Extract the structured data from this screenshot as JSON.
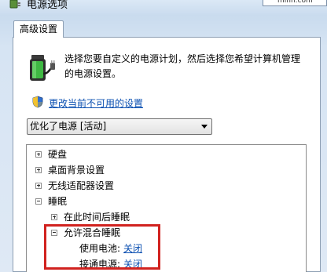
{
  "window": {
    "title": "电源选项",
    "top_right_field_text": "minn.com"
  },
  "tabs": [
    {
      "label": "高级设置"
    }
  ],
  "intro": {
    "text": "选择您要自定义的电源计划，然后选择您希望计算机管理的电源设置。"
  },
  "change_link": {
    "label": "更改当前不可用的设置"
  },
  "plan_select": {
    "value": "优化了电源 [活动]"
  },
  "tree": {
    "items": [
      {
        "label": "硬盘"
      },
      {
        "label": "桌面背景设置"
      },
      {
        "label": "无线适配器设置"
      },
      {
        "label": "睡眠"
      },
      {
        "label": "在此时间后睡眠"
      },
      {
        "label": "允许混合睡眠"
      }
    ],
    "settings": [
      {
        "label": "使用电池:",
        "value": "关闭"
      },
      {
        "label": "接通电源:",
        "value": "关闭"
      }
    ]
  },
  "colors": {
    "link": "#0a4fb1",
    "highlight": "#d1221f"
  },
  "icons": [
    "power-options-icon",
    "battery-plug-icon",
    "uac-shield-icon",
    "dropdown-arrow-icon",
    "scroll-up-icon"
  ]
}
